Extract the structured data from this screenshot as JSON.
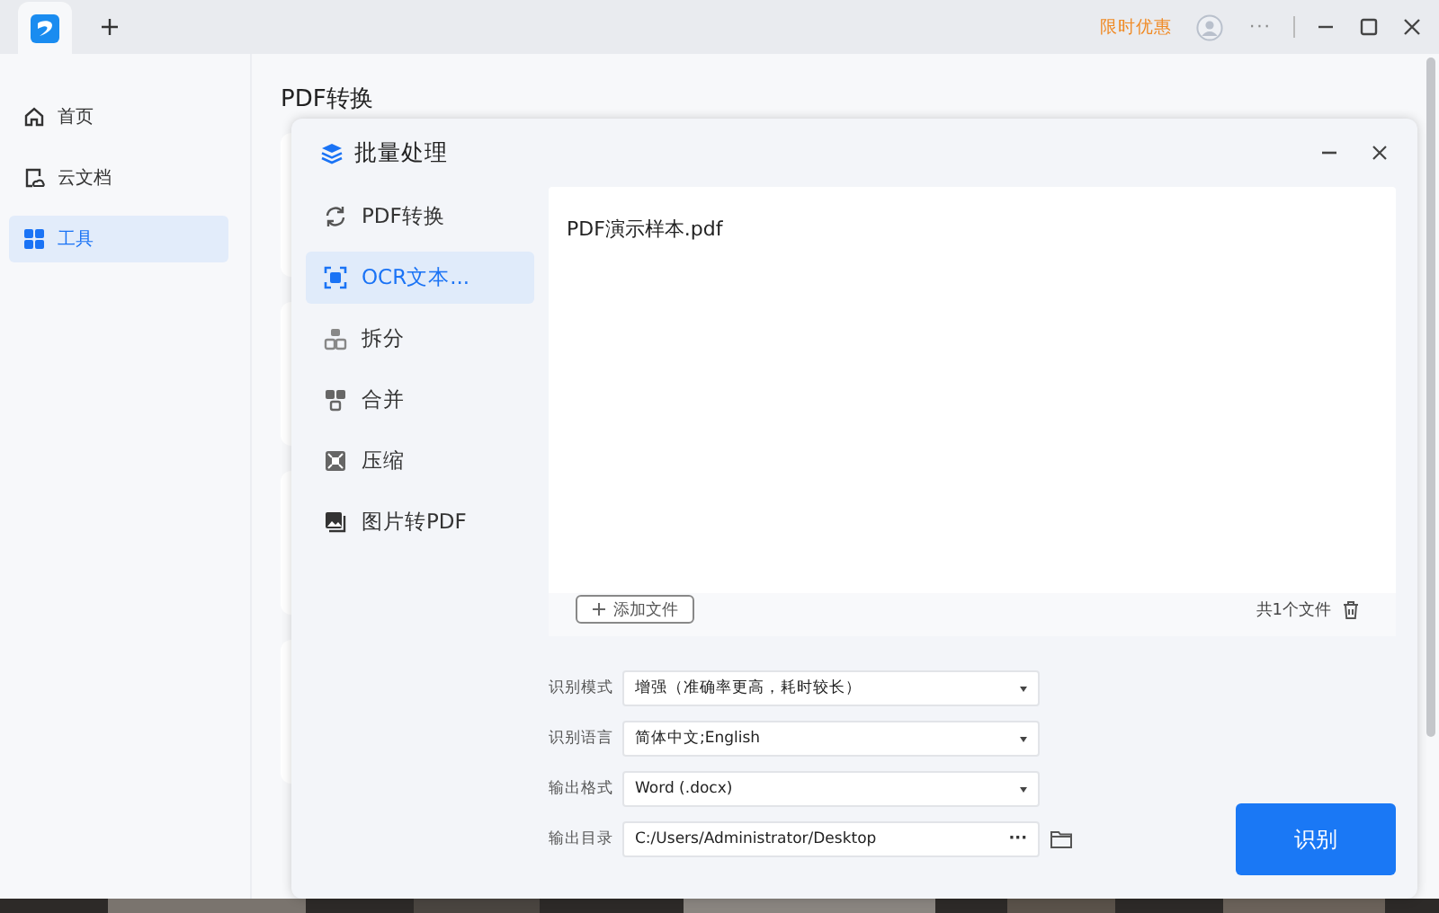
{
  "titlebar": {
    "promo": "限时优惠",
    "menu": "···"
  },
  "sidebar": {
    "items": [
      {
        "label": "首页",
        "selected": false
      },
      {
        "label": "云文档",
        "selected": false
      },
      {
        "label": "工具",
        "selected": true
      }
    ]
  },
  "page": {
    "title": "PDF转换"
  },
  "dialog": {
    "title": "批量处理",
    "nav": [
      {
        "label": "PDF转换",
        "selected": false
      },
      {
        "label": "OCR文本...",
        "selected": true
      },
      {
        "label": "拆分",
        "selected": false
      },
      {
        "label": "合并",
        "selected": false
      },
      {
        "label": "压缩",
        "selected": false
      },
      {
        "label": "图片转PDF",
        "selected": false
      }
    ],
    "files": [
      "PDF演示样本.pdf"
    ],
    "add_button": "添加文件",
    "file_count": "共1个文件",
    "fields": [
      {
        "label": "识别模式",
        "value": "增强（准确率更高，耗时较长）",
        "kind": "select"
      },
      {
        "label": "识别语言",
        "value": "简体中文;English",
        "kind": "select"
      },
      {
        "label": "输出格式",
        "value": "Word (.docx)",
        "kind": "select"
      },
      {
        "label": "输出目录",
        "value": "C:/Users/Administrator/Desktop",
        "kind": "path",
        "browse": "···"
      }
    ],
    "action": "识别"
  }
}
